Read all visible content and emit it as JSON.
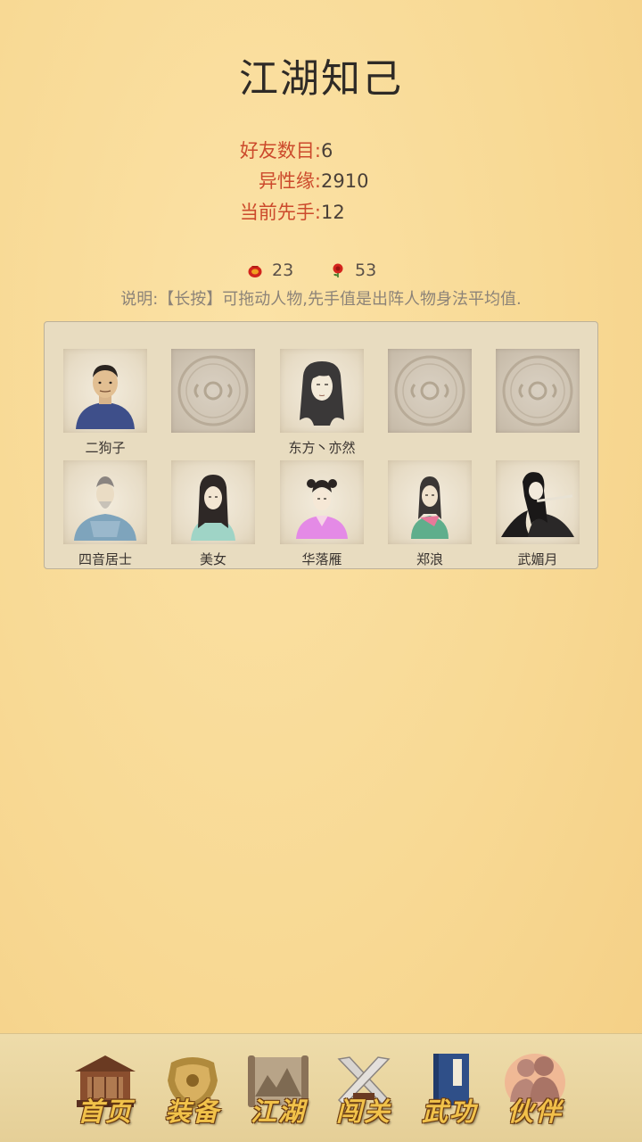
{
  "title": "江湖知己",
  "stats": [
    {
      "label": "好友数目:",
      "value": "6"
    },
    {
      "label": "异性缘:",
      "value": "2910"
    },
    {
      "label": "当前先手:",
      "value": "12"
    }
  ],
  "currency": {
    "bag_count": "23",
    "rose_count": "53"
  },
  "note": "说明:【长按】可拖动人物,先手值是出阵人物身法平均值.",
  "slots": [
    {
      "name": "二狗子",
      "icon": "portrait-man-blue-robe"
    },
    {
      "name": "",
      "icon": "empty-slot-emblem"
    },
    {
      "name": "东方丶亦然",
      "icon": "portrait-long-hair"
    },
    {
      "name": "",
      "icon": "empty-slot-emblem"
    },
    {
      "name": "",
      "icon": "empty-slot-emblem"
    },
    {
      "name": "四音居士",
      "icon": "portrait-hermit"
    },
    {
      "name": "美女",
      "icon": "portrait-beauty"
    },
    {
      "name": "华落雁",
      "icon": "portrait-pink-dress"
    },
    {
      "name": "郑浪",
      "icon": "portrait-green-dress"
    },
    {
      "name": "武媚月",
      "icon": "portrait-flute-player"
    }
  ],
  "nav": [
    {
      "label": "首页",
      "icon": "house-icon"
    },
    {
      "label": "装备",
      "icon": "armor-icon"
    },
    {
      "label": "江湖",
      "icon": "map-scroll-icon"
    },
    {
      "label": "闯关",
      "icon": "crossed-swords-icon"
    },
    {
      "label": "武功",
      "icon": "book-icon"
    },
    {
      "label": "伙伴",
      "icon": "companions-icon",
      "active": true
    }
  ],
  "colors": {
    "label_red": "#cc4a2c",
    "nav_gold": "#f1c24a",
    "background": "#f8d994"
  }
}
